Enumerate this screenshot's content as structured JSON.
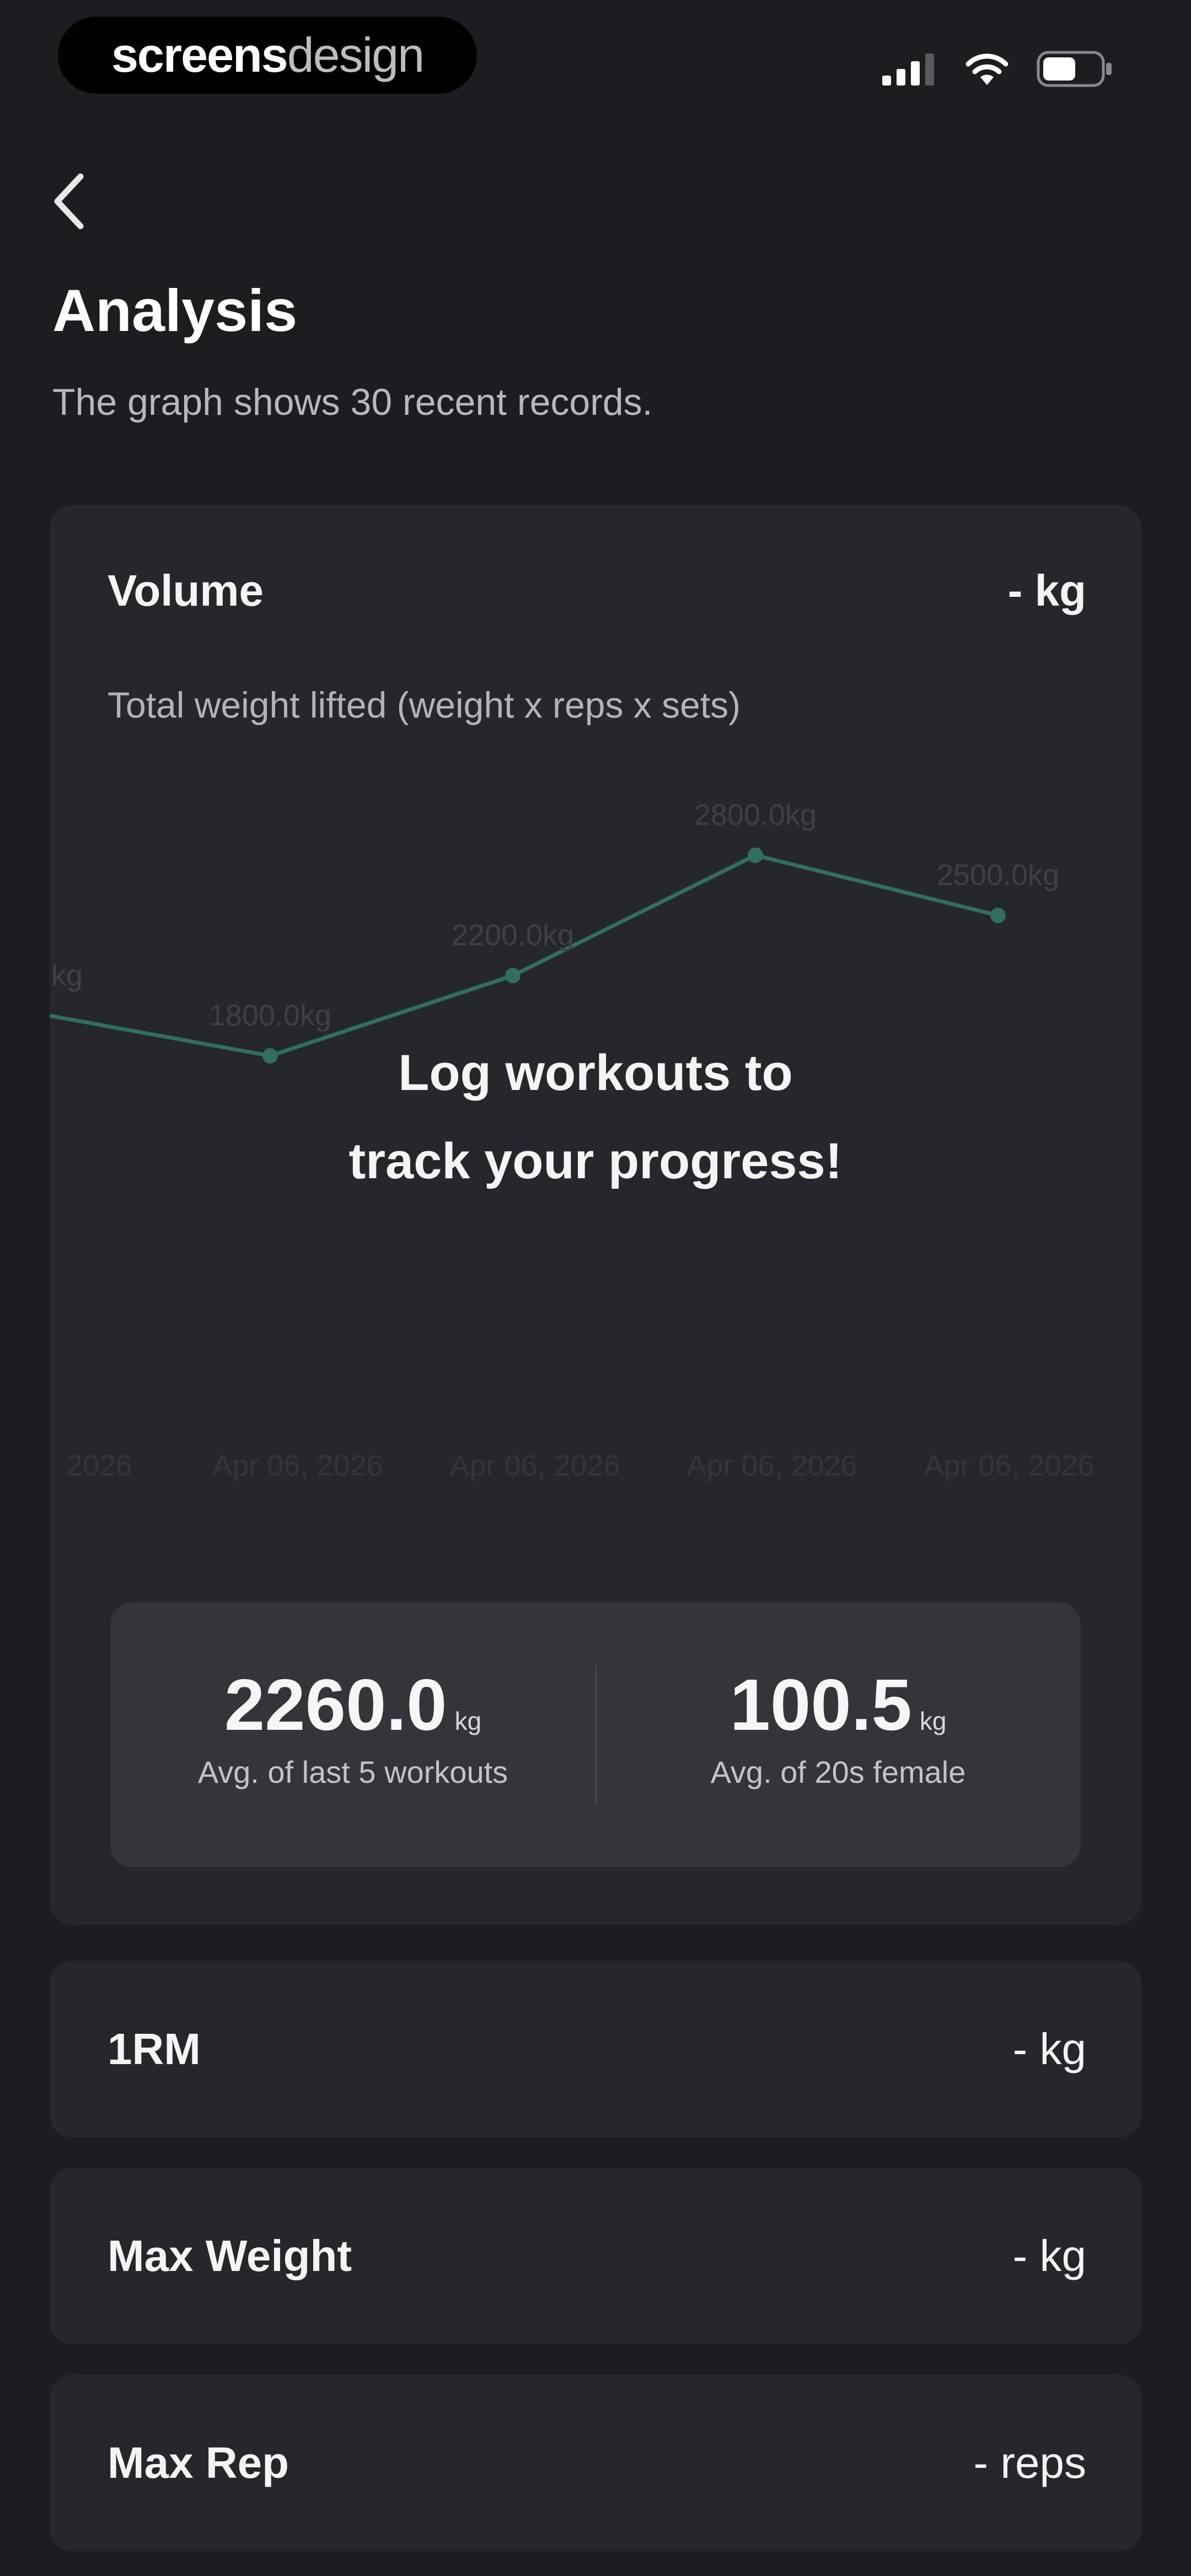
{
  "status_bar": {
    "brand_bold": "screens",
    "brand_light": "design",
    "icons": [
      "cellular-signal-icon",
      "wifi-icon",
      "battery-icon"
    ]
  },
  "header": {
    "back_icon": "chevron-left-icon",
    "title": "Analysis",
    "subtitle": "The graph shows 30 recent records."
  },
  "volume_card": {
    "title": "Volume",
    "value": "- kg",
    "description": "Total weight lifted (weight x reps x sets)",
    "empty_message_line1": "Log workouts to",
    "empty_message_line2": "track your progress!",
    "stats": [
      {
        "value": "2260.0",
        "unit": "kg",
        "label": "Avg. of last 5 workouts"
      },
      {
        "value": "100.5",
        "unit": "kg",
        "label": "Avg. of 20s female"
      }
    ]
  },
  "chart_data": {
    "type": "line",
    "x": [
      "2026",
      "Apr 06, 2026",
      "Apr 06, 2026",
      "Apr 06, 2026",
      "Apr 06, 2026"
    ],
    "series": [
      {
        "values": [
          2000,
          1800,
          2200,
          2800,
          2500
        ],
        "labels": [
          "kg",
          "1800.0kg",
          "2200.0kg",
          "2800.0kg",
          "2500.0kg"
        ]
      }
    ],
    "ylim": [
      1000,
      3200
    ],
    "grid": false,
    "line_color": "#2f6f5c",
    "placeholder": true
  },
  "metrics": [
    {
      "name": "1RM",
      "value": "- kg"
    },
    {
      "name": "Max Weight",
      "value": "- kg"
    },
    {
      "name": "Max Rep",
      "value": "- reps"
    }
  ],
  "colors": {
    "background": "#1c1d21",
    "card": "#26272c",
    "stats_box": "#33353b",
    "accent_line": "#2f6f5c"
  }
}
